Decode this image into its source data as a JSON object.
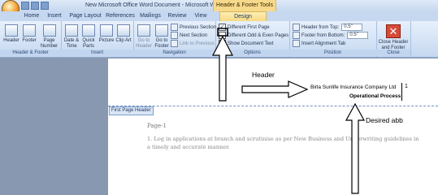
{
  "window": {
    "title": "New Microsoft Office Word Document - Microsoft Word",
    "contextual_tab_group": "Header & Footer Tools"
  },
  "tabs": [
    {
      "label": "Home"
    },
    {
      "label": "Insert"
    },
    {
      "label": "Page Layout"
    },
    {
      "label": "References"
    },
    {
      "label": "Mailings"
    },
    {
      "label": "Review"
    },
    {
      "label": "View"
    },
    {
      "label": "Design"
    }
  ],
  "ribbon": {
    "header_footer": {
      "header_label": "Header",
      "footer_label": "Footer",
      "page_number_label": "Page Number",
      "group_label": "Header & Footer"
    },
    "insert": {
      "date_time_label": "Date & Time",
      "quick_parts_label": "Quick Parts",
      "picture_label": "Picture",
      "clip_art_label": "Clip Art",
      "group_label": "Insert"
    },
    "navigation": {
      "go_to_header_label": "Go to Header",
      "go_to_footer_label": "Go to Footer",
      "previous_section_label": "Previous Section",
      "next_section_label": "Next Section",
      "link_to_previous_label": "Link to Previous",
      "group_label": "Navigation"
    },
    "options": {
      "different_first_page_label": "Different First Page",
      "different_first_page_checked": true,
      "different_odd_even_label": "Different Odd & Even Pages",
      "show_document_text_label": "Show Document Text",
      "group_label": "Options"
    },
    "position": {
      "header_from_top_label": "Header from Top:",
      "header_from_top_value": "0.5\"",
      "footer_from_bottom_label": "Footer from Bottom:",
      "footer_from_bottom_value": "0.5\"",
      "insert_alignment_tab_label": "Insert Alignment Tab",
      "group_label": "Position"
    },
    "close": {
      "close_label": "Close Header and Footer",
      "group_label": "Close"
    }
  },
  "document": {
    "header_line1": "Birla Sunlife Insurance Company Ltd",
    "header_page_number": "1",
    "header_line2": "Operational Process",
    "header_tag": "First Page Header",
    "page_label": "Page-1",
    "body_text": "1. Log in applications at branch and scrutinise as per New Business and Underwriting guidelines in a timely and accurate manner."
  },
  "annotations": {
    "header_note": "Header",
    "desired_note": "Desired abb"
  },
  "colors": {
    "contextual_tab": "#f7d98c",
    "ribbon": "#d3e2f5",
    "document_background": "#8898b0"
  }
}
